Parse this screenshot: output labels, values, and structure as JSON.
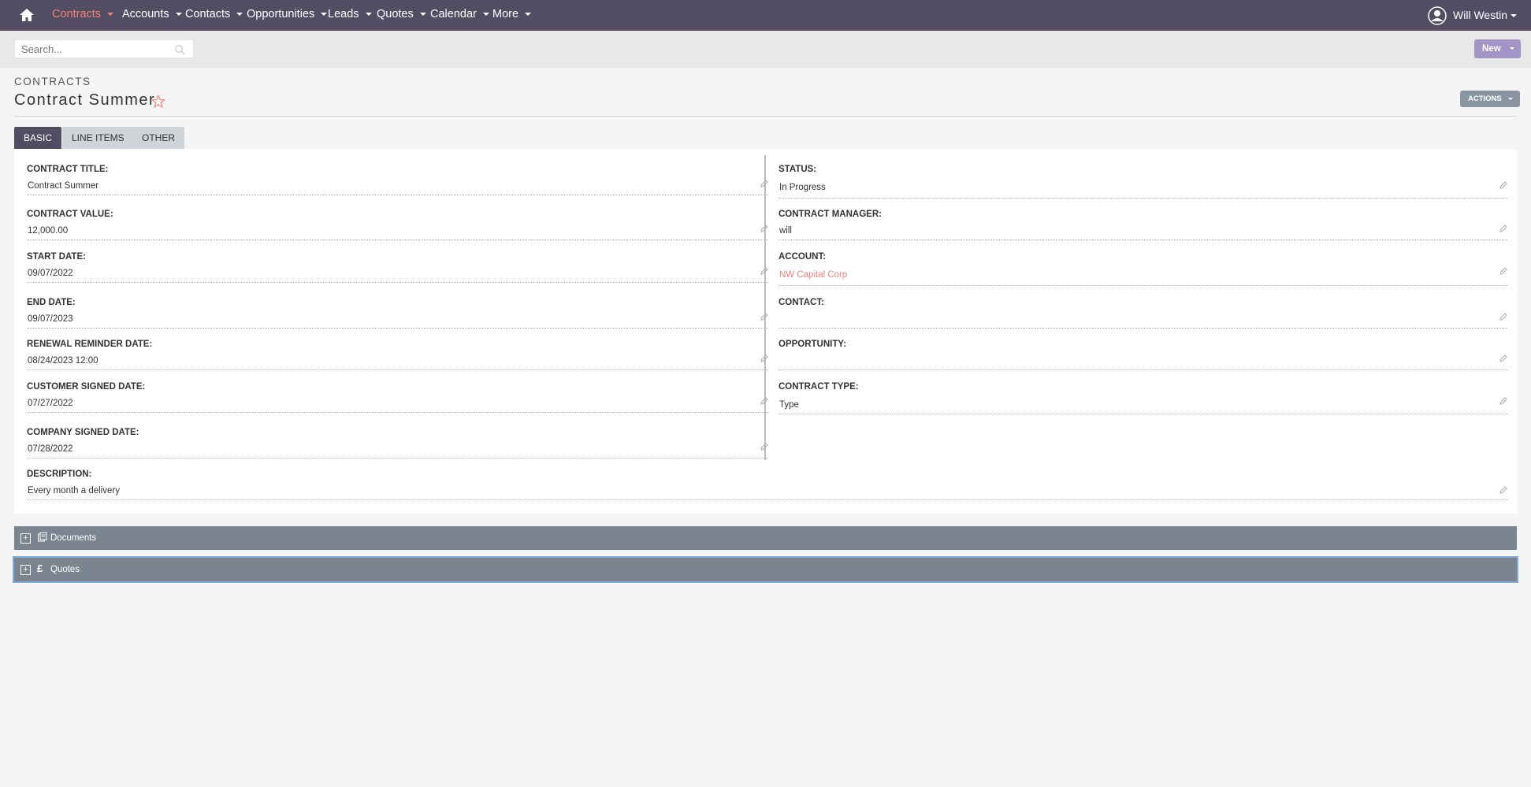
{
  "nav": {
    "items": [
      {
        "label": "Contracts",
        "active": true
      },
      {
        "label": "Accounts"
      },
      {
        "label": "Contacts"
      },
      {
        "label": "Opportunities"
      },
      {
        "label": "Leads"
      },
      {
        "label": "Quotes"
      },
      {
        "label": "Calendar"
      },
      {
        "label": "More"
      }
    ],
    "user_name": "Will Westin"
  },
  "search": {
    "placeholder": "Search..."
  },
  "buttons": {
    "new_label": "New",
    "actions_label": "ACTIONS"
  },
  "header": {
    "module": "CONTRACTS",
    "title": "Contract Summer"
  },
  "tabs": [
    {
      "label": "BASIC",
      "active": true
    },
    {
      "label": "LINE ITEMS"
    },
    {
      "label": "OTHER"
    }
  ],
  "fields": {
    "left": [
      {
        "label": "CONTRACT TITLE:",
        "value": "Contract Summer"
      },
      {
        "label": "CONTRACT VALUE:",
        "value": "12,000.00"
      },
      {
        "label": "START DATE:",
        "value": "09/07/2022"
      },
      {
        "label": "END DATE:",
        "value": "09/07/2023"
      },
      {
        "label": "RENEWAL REMINDER DATE:",
        "value": "08/24/2023 12:00"
      },
      {
        "label": "CUSTOMER SIGNED DATE:",
        "value": "07/27/2022"
      },
      {
        "label": "COMPANY SIGNED DATE:",
        "value": "07/28/2022"
      }
    ],
    "right": [
      {
        "label": "STATUS:",
        "value": "In Progress"
      },
      {
        "label": "CONTRACT MANAGER:",
        "value": "will"
      },
      {
        "label": "ACCOUNT:",
        "value": "NW Capital Corp",
        "is_link": true
      },
      {
        "label": "CONTACT:",
        "value": ""
      },
      {
        "label": "OPPORTUNITY:",
        "value": ""
      },
      {
        "label": "CONTRACT TYPE:",
        "value": "Type"
      }
    ],
    "description": {
      "label": "DESCRIPTION:",
      "value": "Every month a delivery"
    }
  },
  "subpanels": [
    {
      "label": "Documents",
      "icon": "documents-icon"
    },
    {
      "label": "Quotes",
      "icon": "pound-icon",
      "icon_glyph": "£"
    }
  ],
  "colors": {
    "nav_bg": "#534d64",
    "accent": "#f08377",
    "new_btn": "#a294c4",
    "subpanel_bg": "#7b8590"
  }
}
